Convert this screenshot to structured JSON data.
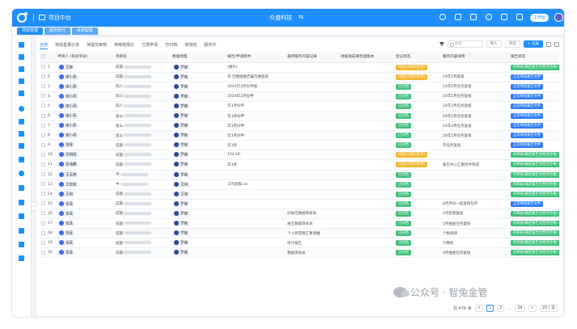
{
  "header": {
    "app_title": "项目中台",
    "center_title": "众盛科技",
    "swap_icon": "⇆",
    "user_pill": "工作台"
  },
  "tabs": [
    {
      "label": "项目管理",
      "active": true
    },
    {
      "label": "服务统计",
      "active": false
    },
    {
      "label": "系统配置",
      "active": false
    }
  ],
  "filters": [
    "全部",
    "待完善报价单",
    "待提交审核",
    "待审核报价",
    "已发申请",
    "已归档",
    "待完结",
    "服务中"
  ],
  "toolbar": {
    "search_placeholder": "搜索",
    "import_label": "导入",
    "export_label": "导出",
    "add_label": "+ 记录"
  },
  "columns": [
    "",
    "",
    "申请人 (系统字段)",
    "项目名",
    "数据经理",
    "报告/申请附件",
    "最终服务内容记录",
    "待报送成果检查版本",
    "登记状态",
    "服务内容详情",
    "报告状态"
  ],
  "rows": [
    {
      "no": "1",
      "applicant": "王静",
      "project": "成都",
      "manager": "罗敏",
      "attach": "(图片)",
      "record": "",
      "check": "",
      "reg": "待登记(资料完善)",
      "reg_color": "yellow",
      "detail": "",
      "report": "待审核(确定报告文档待合格)",
      "report_color": "green"
    },
    {
      "no": "2",
      "applicant": "谢小燕",
      "project": "成都",
      "manager": "罗敏",
      "attach": "开 告数据报告编写维度表",
      "record": "",
      "check": "",
      "reg": "待登记(资料完善)",
      "reg_color": "yellow",
      "detail": "24年5月复核",
      "report": "正常审核报告文件",
      "report_color": "blue"
    },
    {
      "no": "3",
      "applicant": "谢小燕",
      "project": "四川",
      "manager": "罗敏",
      "attach": "2024年3月份申报",
      "record": "",
      "check": "",
      "reg": "已归档",
      "reg_color": "green",
      "detail": "24年6月任务复核",
      "report": "正常审核报告文件",
      "report_color": "blue"
    },
    {
      "no": "4",
      "applicant": "谢小燕",
      "project": "四川",
      "manager": "罗敏",
      "attach": "2024年3月份申",
      "record": "",
      "check": "",
      "reg": "已归档",
      "reg_color": "green",
      "detail": "24年5月任务复核",
      "report": "正常审核报告文件",
      "report_color": "blue"
    },
    {
      "no": "5",
      "applicant": "谢小燕",
      "project": "四川",
      "manager": "罗敏",
      "attach": "年3月份申",
      "record": "",
      "check": "",
      "reg": "已归档",
      "reg_color": "green",
      "detail": "24年3月任务复核",
      "report": "正常审核报告文件",
      "report_color": "blue"
    },
    {
      "no": "6",
      "applicant": "谢小燕",
      "project": "眉山",
      "manager": "罗敏",
      "attach": "年3月份申",
      "record": "",
      "check": "",
      "reg": "已归档",
      "reg_color": "green",
      "detail": "24年5月任务复核",
      "report": "正常审核报告文件",
      "report_color": "blue"
    },
    {
      "no": "7",
      "applicant": "谢小燕",
      "project": "眉山",
      "manager": "罗敏",
      "attach": "年3月份申",
      "record": "",
      "check": "",
      "reg": "已归档",
      "reg_color": "green",
      "detail": "24年4月任务复核",
      "report": "正常审核报告文件",
      "report_color": "blue"
    },
    {
      "no": "8",
      "applicant": "谢小燕",
      "project": "眉山",
      "manager": "罗敏",
      "attach": "年3月份申",
      "record": "",
      "check": "",
      "reg": "已归档",
      "reg_color": "green",
      "detail": "24年5月任务复核",
      "report": "正常审核报告文件",
      "report_color": "blue"
    },
    {
      "no": "9",
      "applicant": "张琴",
      "project": "成都",
      "manager": "罗敏",
      "attach": "年3月",
      "record": "",
      "check": "",
      "reg": "已归档",
      "reg_color": "green",
      "detail": "年任务复核",
      "report": "正常审核报告文件",
      "report_color": "blue"
    },
    {
      "no": "10",
      "applicant": "吴明辉",
      "project": "成都",
      "manager": "罗敏",
      "attach": "104.SR",
      "record": "",
      "check": "",
      "reg": "待登记(资料完善)",
      "reg_color": "yellow",
      "detail": "",
      "report": "待审核(确定报告文档待合格)",
      "report_color": "green"
    },
    {
      "no": "11",
      "applicant": "周海鹏",
      "project": "成都",
      "manager": "罗敏",
      "attach": "年3月",
      "record": "",
      "check": "",
      "reg": "待登记(资料完善)",
      "reg_color": "yellow",
      "detail": "报告中心汇集附件完成",
      "report": "待审核(确定报告文档待合格)",
      "report_color": "green"
    },
    {
      "no": "12",
      "applicant": "王玉婷",
      "project": "平",
      "manager": "罗敏",
      "attach": "",
      "record": "",
      "check": "",
      "reg": "已归档",
      "reg_color": "green",
      "detail": "",
      "report": "待审核(确定报告文档待合格)",
      "report_color": "green"
    },
    {
      "no": "13",
      "applicant": "王宏图",
      "project": "中",
      "manager": "王琪",
      "attach": "工作底稿.xls",
      "record": "",
      "check": "",
      "reg": "已归档",
      "reg_color": "green",
      "detail": "",
      "report": "待审核(确定报告文档待合格)",
      "report_color": "green"
    },
    {
      "no": "14",
      "applicant": "王琪",
      "project": "成都",
      "manager": "王琪",
      "attach": "",
      "record": "",
      "check": "",
      "reg": "已归档",
      "reg_color": "green",
      "detail": "",
      "report": "待审核(确定报告文档待合格)",
      "report_color": "green"
    },
    {
      "no": "15",
      "applicant": "张蓝",
      "project": "成都",
      "manager": "罗敏",
      "attach": "",
      "record": "",
      "check": "",
      "reg": "已归档",
      "reg_color": "green",
      "detail": "8月月份一起复核任务",
      "report": "正常审核报告文件",
      "report_color": "blue"
    },
    {
      "no": "16",
      "applicant": "张蓝",
      "project": "成都",
      "manager": "罗敏",
      "attach": "",
      "record": "好报告数据审核表",
      "check": "",
      "reg": "已归档",
      "reg_color": "green",
      "detail": "5月定期复核",
      "report": "待审核(确定报告文档待合格)",
      "report_color": "green"
    },
    {
      "no": "17",
      "applicant": "张蓝",
      "project": "成都",
      "manager": "罗敏",
      "attach": "",
      "record": "报告数据审核表",
      "check": "",
      "reg": "已归档",
      "reg_color": "green",
      "detail": "5月抽查任务复核",
      "report": "待审核(确定报告文档待合格)",
      "report_color": "green"
    },
    {
      "no": "18",
      "applicant": "张蓝",
      "project": "成都",
      "manager": "罗敏",
      "attach": "",
      "record": "个人所得税汇算清缴",
      "check": "",
      "reg": "已归档",
      "reg_color": "green",
      "detail": "个税调研",
      "report": "待审核(确定报告文档待合格)",
      "report_color": "green"
    },
    {
      "no": "19",
      "applicant": "张蓝",
      "project": "成都",
      "manager": "罗敏",
      "attach": "",
      "record": "审计报告",
      "check": "",
      "reg": "已归档",
      "reg_color": "green",
      "detail": "计算机",
      "report": "待审核(确定报告文档待合格)",
      "report_color": "green"
    },
    {
      "no": "20",
      "applicant": "张蓝",
      "project": "成都",
      "manager": "罗敏",
      "attach": "",
      "record": "数据审核表",
      "check": "",
      "reg": "已归档",
      "reg_color": "green",
      "detail": "4月抽查任务复核",
      "report": "待审核(确定报告文档待合格)",
      "report_color": "green"
    }
  ],
  "pager": {
    "total": "共 476 条",
    "prev": "<",
    "page1": "1",
    "page2": "2",
    "ellipsis": "...",
    "last": "24",
    "next": ">",
    "size": "20 / 页"
  },
  "watermark": "公众号 · 智兔金管"
}
